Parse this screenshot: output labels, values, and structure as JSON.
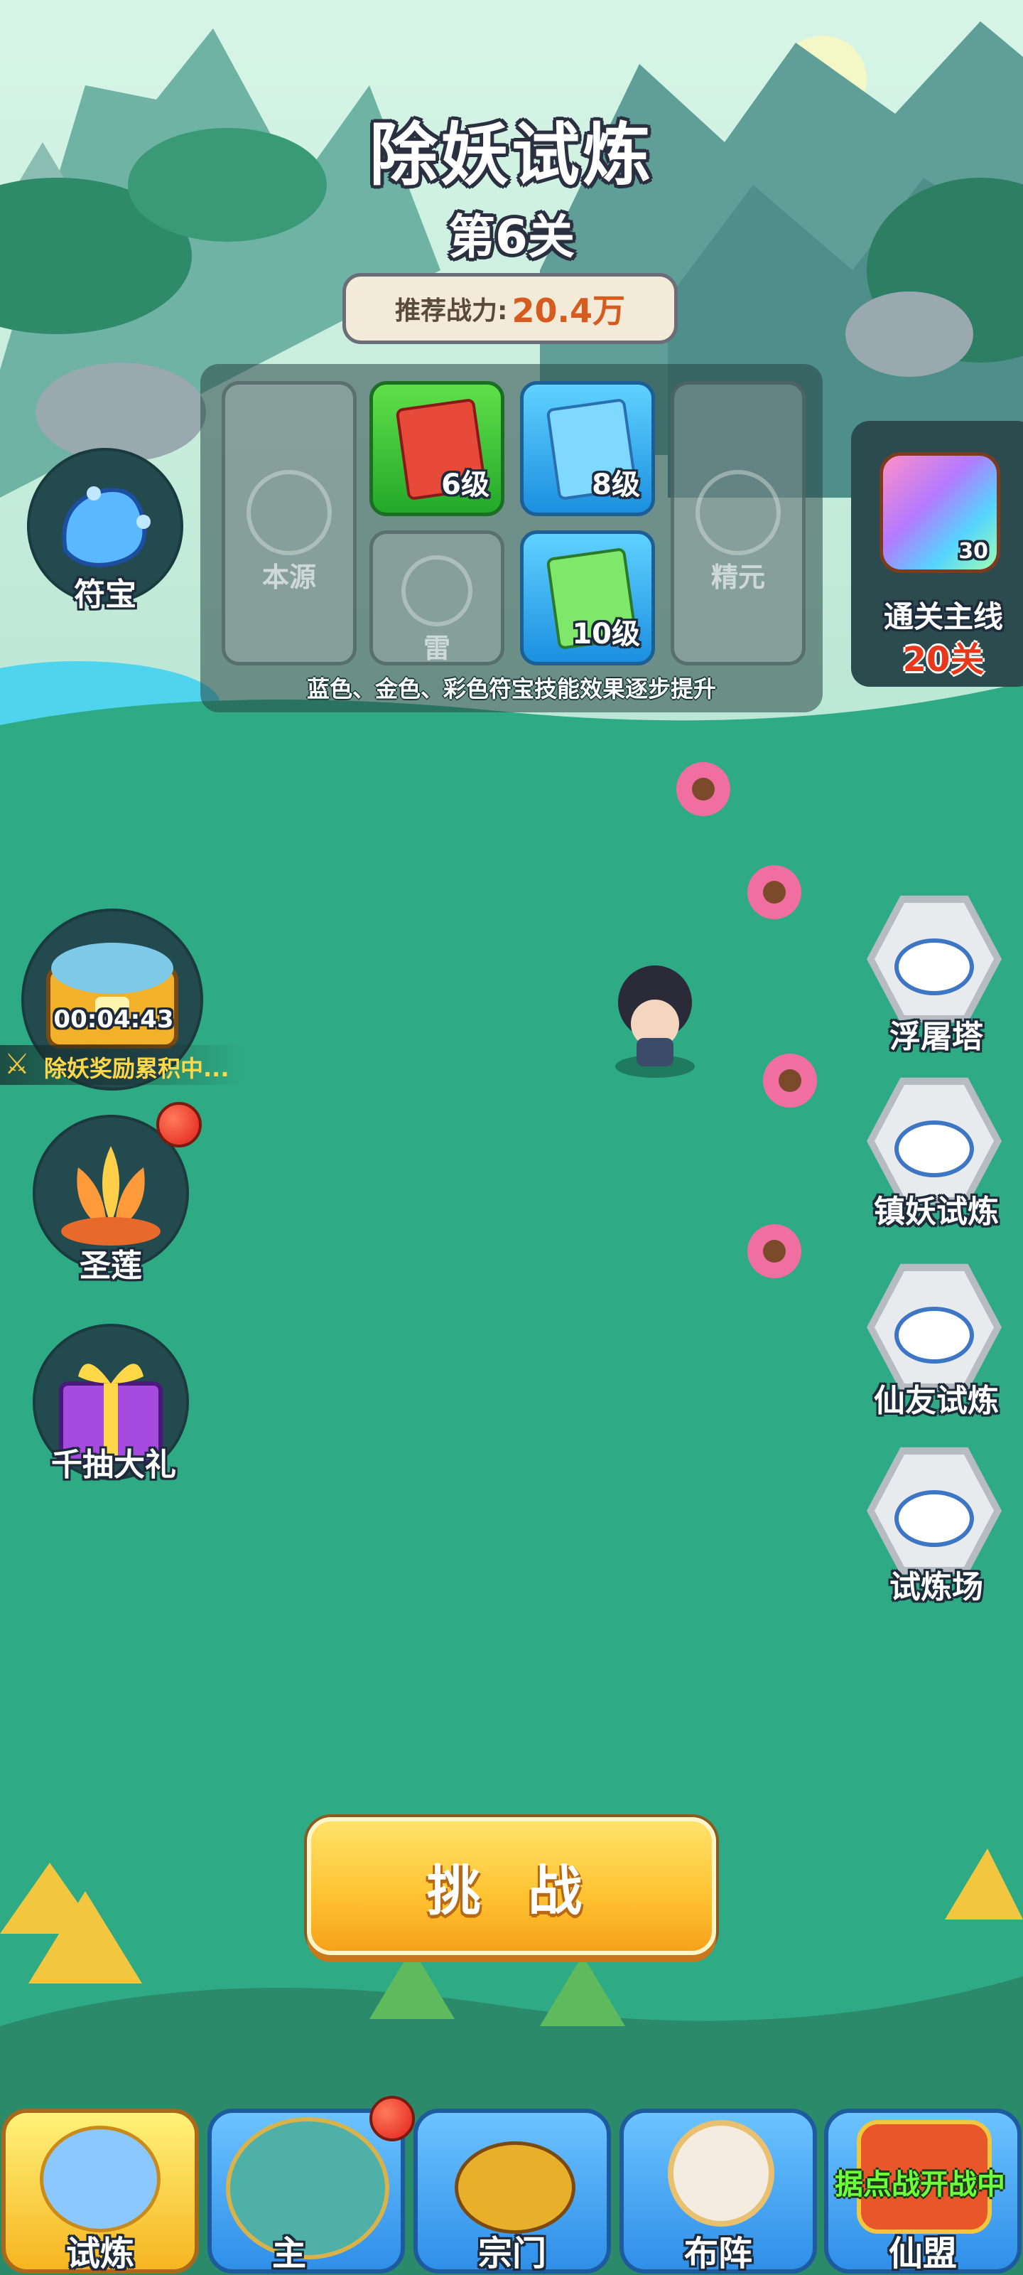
{
  "header": {
    "title": "除妖试炼",
    "stage": "第6关",
    "power_label": "推荐战力:",
    "power_value": "20.4万"
  },
  "talisman_panel": {
    "slots": [
      {
        "label": "本源",
        "state": "empty"
      },
      {
        "level": "6级",
        "state": "green"
      },
      {
        "level": "8级",
        "state": "blue"
      },
      {
        "label": "精元",
        "state": "empty"
      },
      {
        "label": "雷",
        "state": "empty"
      },
      {
        "level": "10级",
        "state": "blue"
      }
    ],
    "hint": "蓝色、金色、彩色符宝技能效果逐步提升"
  },
  "left_menu": {
    "treasure_label": "符宝",
    "chest_timer": "00:04:43",
    "reward_status": "除妖奖励累积中...",
    "lotus_label": "圣莲",
    "gift_label": "千抽大礼"
  },
  "mainline": {
    "item_count": "30",
    "label": "通关主线",
    "stages": "20关"
  },
  "right_modes": [
    {
      "label": "浮屠塔"
    },
    {
      "label": "镇妖试炼"
    },
    {
      "label": "仙友试炼"
    },
    {
      "label": "试炼场"
    }
  ],
  "challenge_button": "挑 战",
  "bottom_nav": {
    "tabs": [
      {
        "label": "试炼"
      },
      {
        "label": "主"
      },
      {
        "label": "宗门"
      },
      {
        "label": "布阵"
      },
      {
        "label": "仙盟"
      }
    ],
    "banner": "据点战开战中"
  },
  "colors": {
    "ground": "#2eaa84",
    "accent_orange": "#d65b1f",
    "button_yellow": "#ffc12f",
    "stage_red": "#e8381a"
  }
}
